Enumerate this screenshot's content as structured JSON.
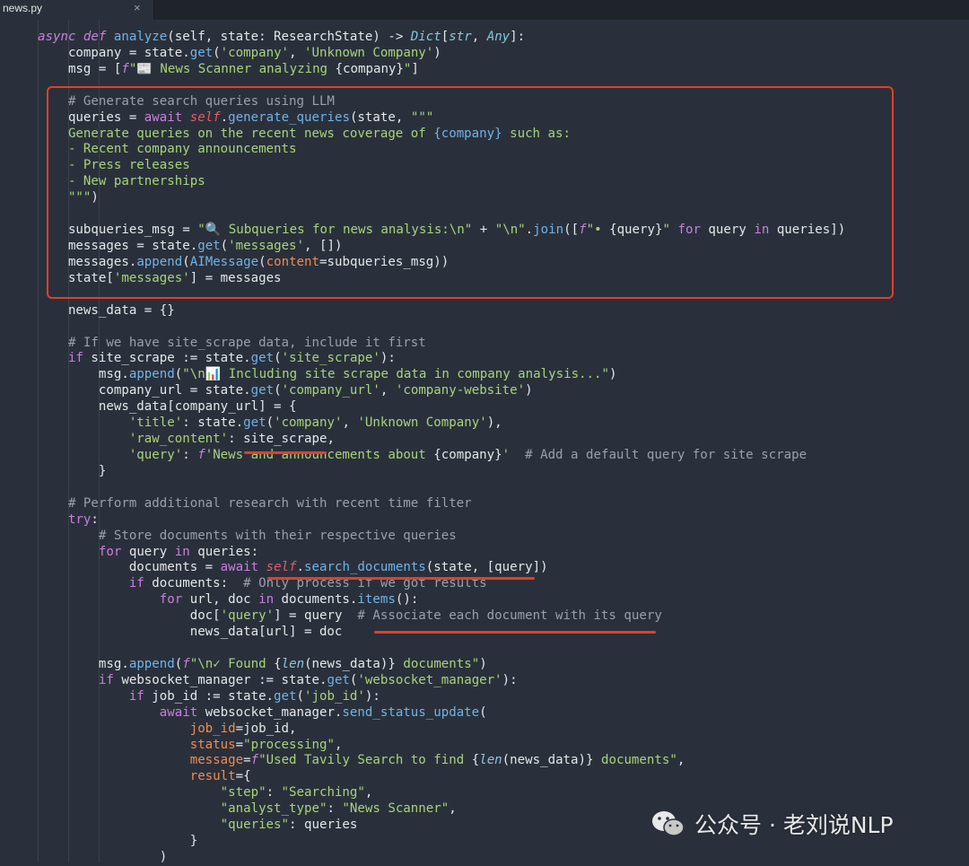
{
  "tab": {
    "filename": "news.py",
    "close": "×"
  },
  "watermark": {
    "text": "公众号 · 老刘说NLP",
    "icon": "wechat-icon"
  },
  "colors": {
    "highlight": "#e0402a",
    "background": "#2a303b"
  },
  "code_lines": [
    [
      [
        "kwi",
        "async def "
      ],
      [
        "fn",
        "analyze"
      ],
      [
        "op",
        "(self, state: ResearchState) -> "
      ],
      [
        "ty",
        "Dict"
      ],
      [
        "op",
        "["
      ],
      [
        "ty",
        "str"
      ],
      [
        "op",
        ", "
      ],
      [
        "ty",
        "Any"
      ],
      [
        "op",
        "]:"
      ]
    ],
    [
      [
        "op",
        "    company = state."
      ],
      [
        "fn",
        "get"
      ],
      [
        "op",
        "("
      ],
      [
        "str",
        "'company'"
      ],
      [
        "op",
        ", "
      ],
      [
        "str",
        "'Unknown Company'"
      ],
      [
        "op",
        ")"
      ]
    ],
    [
      [
        "op",
        "    msg = ["
      ],
      [
        "fpre",
        "f"
      ],
      [
        "str",
        "\"📰 News Scanner analyzing "
      ],
      [
        "op",
        "{company}"
      ],
      [
        "str",
        "\""
      ],
      [
        "op",
        "]"
      ]
    ],
    [
      [
        "op",
        ""
      ]
    ],
    [
      [
        "cm",
        "    # Generate search queries using LLM"
      ]
    ],
    [
      [
        "op",
        "    queries = "
      ],
      [
        "kw",
        "await "
      ],
      [
        "slf",
        "self"
      ],
      [
        "op",
        "."
      ],
      [
        "fn",
        "generate_queries"
      ],
      [
        "op",
        "(state, "
      ],
      [
        "str",
        "\"\"\""
      ]
    ],
    [
      [
        "str",
        "    Generate queries on the recent news coverage of "
      ],
      [
        "fn",
        "{company}"
      ],
      [
        "str",
        " such as:"
      ]
    ],
    [
      [
        "str",
        "    - Recent company announcements"
      ]
    ],
    [
      [
        "str",
        "    - Press releases"
      ]
    ],
    [
      [
        "str",
        "    - New partnerships"
      ]
    ],
    [
      [
        "str",
        "    \"\"\""
      ],
      [
        "op",
        ")"
      ]
    ],
    [
      [
        "op",
        ""
      ]
    ],
    [
      [
        "op",
        "    subqueries_msg = "
      ],
      [
        "str",
        "\"🔍 Subqueries for news analysis:\\n\""
      ],
      [
        "op",
        " + "
      ],
      [
        "str",
        "\"\\n\""
      ],
      [
        "op",
        "."
      ],
      [
        "fn",
        "join"
      ],
      [
        "op",
        "(["
      ],
      [
        "fpre",
        "f"
      ],
      [
        "str",
        "\"• "
      ],
      [
        "op",
        "{query}"
      ],
      [
        "str",
        "\""
      ],
      [
        "kw",
        " for "
      ],
      [
        "op",
        "query "
      ],
      [
        "kw",
        "in "
      ],
      [
        "op",
        "queries])"
      ]
    ],
    [
      [
        "op",
        "    messages = state."
      ],
      [
        "fn",
        "get"
      ],
      [
        "op",
        "("
      ],
      [
        "str",
        "'messages'"
      ],
      [
        "op",
        ", [])"
      ]
    ],
    [
      [
        "op",
        "    messages."
      ],
      [
        "fn",
        "append"
      ],
      [
        "op",
        "("
      ],
      [
        "fn",
        "AIMessage"
      ],
      [
        "op",
        "("
      ],
      [
        "prm",
        "content"
      ],
      [
        "op",
        "=subqueries_msg))"
      ]
    ],
    [
      [
        "op",
        "    state["
      ],
      [
        "str",
        "'messages'"
      ],
      [
        "op",
        "] = messages"
      ]
    ],
    [
      [
        "op",
        ""
      ]
    ],
    [
      [
        "op",
        "    news_data = {}"
      ]
    ],
    [
      [
        "op",
        ""
      ]
    ],
    [
      [
        "cm",
        "    # If we have site_scrape data, include it first"
      ]
    ],
    [
      [
        "kw",
        "    if "
      ],
      [
        "op",
        "site_scrape := state."
      ],
      [
        "fn",
        "get"
      ],
      [
        "op",
        "("
      ],
      [
        "str",
        "'site_scrape'"
      ],
      [
        "op",
        "):"
      ]
    ],
    [
      [
        "op",
        "        msg."
      ],
      [
        "fn",
        "append"
      ],
      [
        "op",
        "("
      ],
      [
        "str",
        "\"\\n📊 Including site scrape data in company analysis...\""
      ],
      [
        "op",
        ")"
      ]
    ],
    [
      [
        "op",
        "        company_url = state."
      ],
      [
        "fn",
        "get"
      ],
      [
        "op",
        "("
      ],
      [
        "str",
        "'company_url'"
      ],
      [
        "op",
        ", "
      ],
      [
        "str",
        "'company-website'"
      ],
      [
        "op",
        ")"
      ]
    ],
    [
      [
        "op",
        "        news_data[company_url] = {"
      ]
    ],
    [
      [
        "str",
        "            'title'"
      ],
      [
        "op",
        ": state."
      ],
      [
        "fn",
        "get"
      ],
      [
        "op",
        "("
      ],
      [
        "str",
        "'company'"
      ],
      [
        "op",
        ", "
      ],
      [
        "str",
        "'Unknown Company'"
      ],
      [
        "op",
        "),"
      ]
    ],
    [
      [
        "str",
        "            'raw_content'"
      ],
      [
        "op",
        ": site_scrape,"
      ]
    ],
    [
      [
        "str",
        "            'query'"
      ],
      [
        "op",
        ": "
      ],
      [
        "fpre",
        "f"
      ],
      [
        "str",
        "'News and announcements about "
      ],
      [
        "op",
        "{company}"
      ],
      [
        "str",
        "'"
      ],
      [
        "cm",
        "  # Add a default query for site scrape"
      ]
    ],
    [
      [
        "op",
        "        }"
      ]
    ],
    [
      [
        "op",
        ""
      ]
    ],
    [
      [
        "cm",
        "    # Perform additional research with recent time filter"
      ]
    ],
    [
      [
        "kw",
        "    try"
      ],
      [
        "op",
        ":"
      ]
    ],
    [
      [
        "cm",
        "        # Store documents with their respective queries"
      ]
    ],
    [
      [
        "kw",
        "        for "
      ],
      [
        "op",
        "query "
      ],
      [
        "kw",
        "in "
      ],
      [
        "op",
        "queries:"
      ]
    ],
    [
      [
        "op",
        "            documents = "
      ],
      [
        "kw",
        "await "
      ],
      [
        "slf",
        "self"
      ],
      [
        "op",
        "."
      ],
      [
        "fn",
        "search_documents"
      ],
      [
        "op",
        "(state, [query])"
      ]
    ],
    [
      [
        "kw",
        "            if "
      ],
      [
        "op",
        "documents:  "
      ],
      [
        "cm",
        "# Only process if we got results"
      ]
    ],
    [
      [
        "kw",
        "                for "
      ],
      [
        "op",
        "url, doc "
      ],
      [
        "kw",
        "in "
      ],
      [
        "op",
        "documents."
      ],
      [
        "fn",
        "items"
      ],
      [
        "op",
        "():"
      ]
    ],
    [
      [
        "op",
        "                    doc["
      ],
      [
        "str",
        "'query'"
      ],
      [
        "op",
        "] = query  "
      ],
      [
        "cm",
        "# Associate each document with its query"
      ]
    ],
    [
      [
        "op",
        "                    news_data[url] = doc"
      ]
    ],
    [
      [
        "op",
        ""
      ]
    ],
    [
      [
        "op",
        "        msg."
      ],
      [
        "fn",
        "append"
      ],
      [
        "op",
        "("
      ],
      [
        "fpre",
        "f"
      ],
      [
        "str",
        "\"\\n✓ Found "
      ],
      [
        "op",
        "{"
      ],
      [
        "ty",
        "len"
      ],
      [
        "op",
        "(news_data)}"
      ],
      [
        "str",
        " documents\""
      ],
      [
        "op",
        ")"
      ]
    ],
    [
      [
        "kw",
        "        if "
      ],
      [
        "op",
        "websocket_manager := state."
      ],
      [
        "fn",
        "get"
      ],
      [
        "op",
        "("
      ],
      [
        "str",
        "'websocket_manager'"
      ],
      [
        "op",
        "):"
      ]
    ],
    [
      [
        "kw",
        "            if "
      ],
      [
        "op",
        "job_id := state."
      ],
      [
        "fn",
        "get"
      ],
      [
        "op",
        "("
      ],
      [
        "str",
        "'job_id'"
      ],
      [
        "op",
        "):"
      ]
    ],
    [
      [
        "kw",
        "                await "
      ],
      [
        "op",
        "websocket_manager."
      ],
      [
        "fn",
        "send_status_update"
      ],
      [
        "op",
        "("
      ]
    ],
    [
      [
        "prm",
        "                    job_id"
      ],
      [
        "op",
        "=job_id,"
      ]
    ],
    [
      [
        "prm",
        "                    status"
      ],
      [
        "op",
        "="
      ],
      [
        "str",
        "\"processing\""
      ],
      [
        "op",
        ","
      ]
    ],
    [
      [
        "prm",
        "                    message"
      ],
      [
        "op",
        "="
      ],
      [
        "fpre",
        "f"
      ],
      [
        "str",
        "\"Used Tavily Search to find "
      ],
      [
        "op",
        "{"
      ],
      [
        "ty",
        "len"
      ],
      [
        "op",
        "(news_data)}"
      ],
      [
        "str",
        " documents\""
      ],
      [
        "op",
        ","
      ]
    ],
    [
      [
        "prm",
        "                    result"
      ],
      [
        "op",
        "={"
      ]
    ],
    [
      [
        "str",
        "                        \"step\""
      ],
      [
        "op",
        ": "
      ],
      [
        "str",
        "\"Searching\""
      ],
      [
        "op",
        ","
      ]
    ],
    [
      [
        "str",
        "                        \"analyst_type\""
      ],
      [
        "op",
        ": "
      ],
      [
        "str",
        "\"News Scanner\""
      ],
      [
        "op",
        ","
      ]
    ],
    [
      [
        "str",
        "                        \"queries\""
      ],
      [
        "op",
        ": queries"
      ]
    ],
    [
      [
        "op",
        "                    }"
      ]
    ],
    [
      [
        "op",
        "                )"
      ]
    ]
  ]
}
